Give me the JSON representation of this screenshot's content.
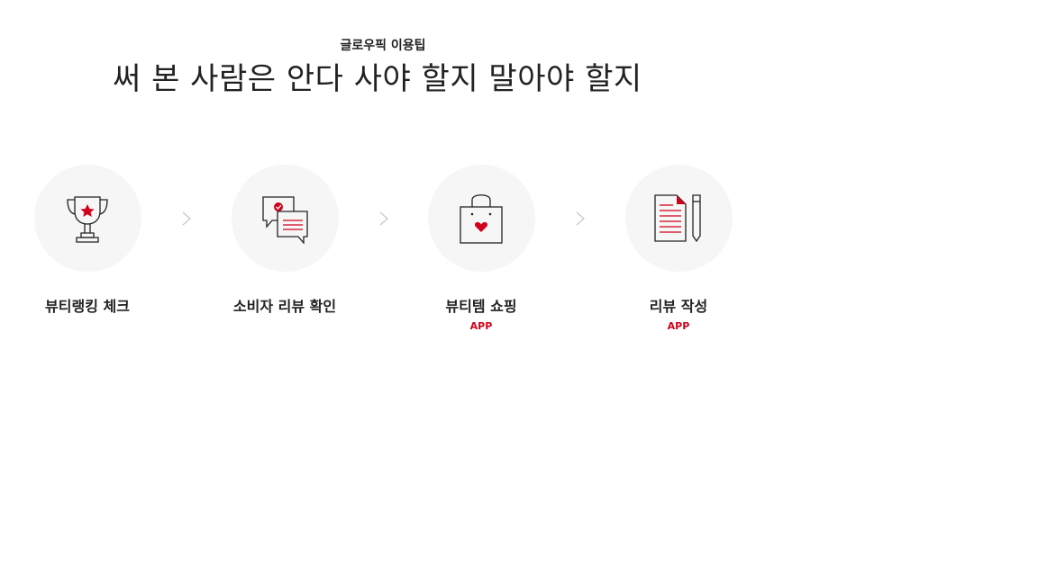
{
  "section": {
    "eyebrow": "글로우픽 이용팁",
    "headline": "써 본 사람은 안다 사야 할지 말아야 할지"
  },
  "steps": [
    {
      "label": "뷰티랭킹 체크",
      "icon": "trophy-icon",
      "badge": ""
    },
    {
      "label": "소비자 리뷰 확인",
      "icon": "chat-bubbles-icon",
      "badge": ""
    },
    {
      "label": "뷰티템 쇼핑",
      "icon": "shopping-bag-icon",
      "badge": "APP"
    },
    {
      "label": "리뷰 작성",
      "icon": "document-pen-icon",
      "badge": "APP"
    }
  ],
  "colors": {
    "accent": "#d0021b",
    "text": "#222222",
    "circle_bg": "#f6f6f6",
    "chevron": "#c8c8c8"
  }
}
